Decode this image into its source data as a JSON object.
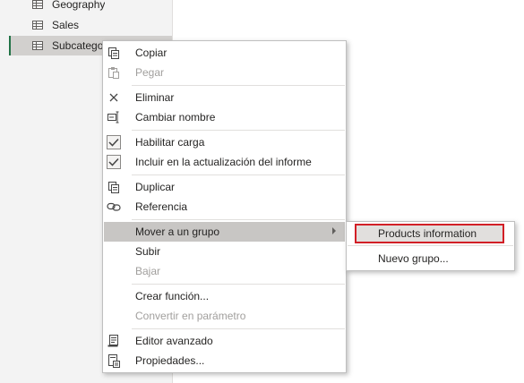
{
  "queries": [
    {
      "label": "Geography",
      "icon": "table-icon",
      "selected": false
    },
    {
      "label": "Sales",
      "icon": "table-icon",
      "selected": false
    },
    {
      "label": "Subcatego",
      "icon": "table-icon",
      "selected": true
    }
  ],
  "menu": {
    "copy": "Copiar",
    "paste": "Pegar",
    "delete": "Eliminar",
    "rename": "Cambiar nombre",
    "enable_load": "Habilitar carga",
    "include_refresh": "Incluir en la actualización del informe",
    "duplicate": "Duplicar",
    "reference": "Referencia",
    "move_to_group": "Mover a un grupo",
    "move_up": "Subir",
    "move_down": "Bajar",
    "create_function": "Crear función...",
    "convert_parameter": "Convertir en parámetro",
    "advanced_editor": "Editor avanzado",
    "properties": "Propiedades..."
  },
  "submenu": {
    "products_information": "Products information",
    "new_group": "Nuevo grupo..."
  },
  "colors": {
    "highlight_border": "#d21f26",
    "selected_accent": "#217346"
  }
}
